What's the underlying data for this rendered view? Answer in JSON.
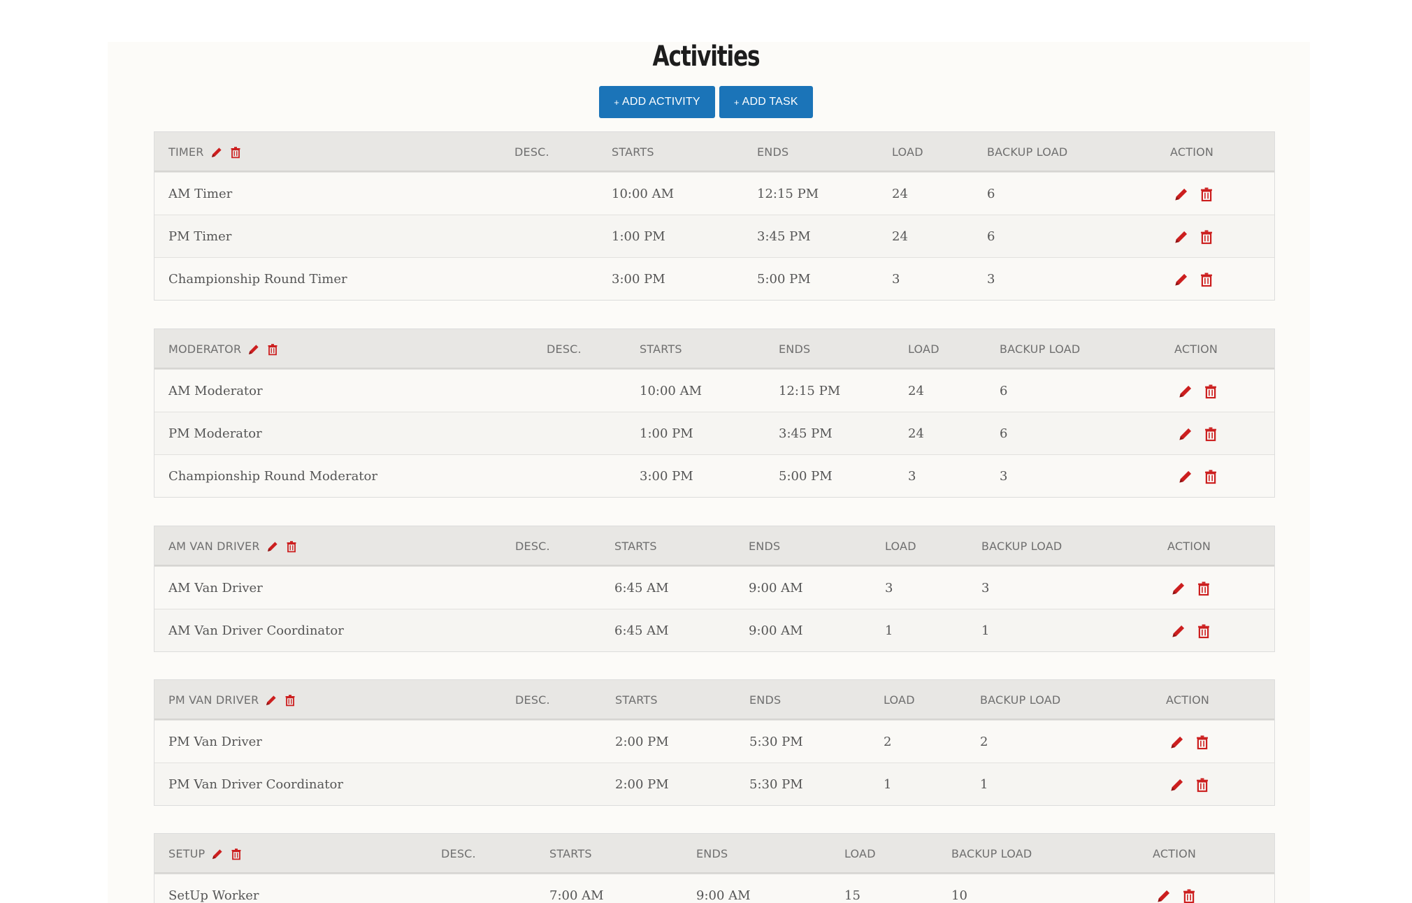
{
  "page": {
    "title": "Activities",
    "add_activity_label": "ADD ACTIVITY",
    "add_task_label": "ADD TASK",
    "plus": "+"
  },
  "colors": {
    "button": "#1b74b8",
    "icon_red": "#cc1f1f",
    "header_bg": "#e8e7e4"
  },
  "icons": {
    "edit": "pencil-icon",
    "delete": "trash-icon"
  },
  "columns": {
    "desc": "DESC.",
    "starts": "STARTS",
    "ends": "ENDS",
    "load": "LOAD",
    "backup": "BACKUP LOAD",
    "action": "ACTION"
  },
  "groups": [
    {
      "name": "TIMER",
      "rows": [
        {
          "name": "AM Timer",
          "starts": "10:00 AM",
          "ends": "12:15 PM",
          "load": "24",
          "backup": "6"
        },
        {
          "name": "PM Timer",
          "starts": "1:00 PM",
          "ends": "3:45 PM",
          "load": "24",
          "backup": "6"
        },
        {
          "name": "Championship Round Timer",
          "starts": "3:00 PM",
          "ends": "5:00 PM",
          "load": "3",
          "backup": "3"
        }
      ]
    },
    {
      "name": "MODERATOR",
      "rows": [
        {
          "name": "AM Moderator",
          "starts": "10:00 AM",
          "ends": "12:15 PM",
          "load": "24",
          "backup": "6"
        },
        {
          "name": "PM Moderator",
          "starts": "1:00 PM",
          "ends": "3:45 PM",
          "load": "24",
          "backup": "6"
        },
        {
          "name": "Championship Round Moderator",
          "starts": "3:00 PM",
          "ends": "5:00 PM",
          "load": "3",
          "backup": "3"
        }
      ]
    },
    {
      "name": "AM VAN DRIVER",
      "rows": [
        {
          "name": "AM Van Driver",
          "starts": "6:45 AM",
          "ends": "9:00 AM",
          "load": "3",
          "backup": "3"
        },
        {
          "name": "AM Van Driver Coordinator",
          "starts": "6:45 AM",
          "ends": "9:00 AM",
          "load": "1",
          "backup": "1"
        }
      ]
    },
    {
      "name": "PM VAN DRIVER",
      "rows": [
        {
          "name": "PM Van Driver",
          "starts": "2:00 PM",
          "ends": "5:30 PM",
          "load": "2",
          "backup": "2"
        },
        {
          "name": "PM Van Driver Coordinator",
          "starts": "2:00 PM",
          "ends": "5:30 PM",
          "load": "1",
          "backup": "1"
        }
      ]
    },
    {
      "name": "SETUP",
      "rows": [
        {
          "name": "SetUp Worker",
          "starts": "7:00 AM",
          "ends": "9:00 AM",
          "load": "15",
          "backup": "10"
        }
      ]
    }
  ]
}
